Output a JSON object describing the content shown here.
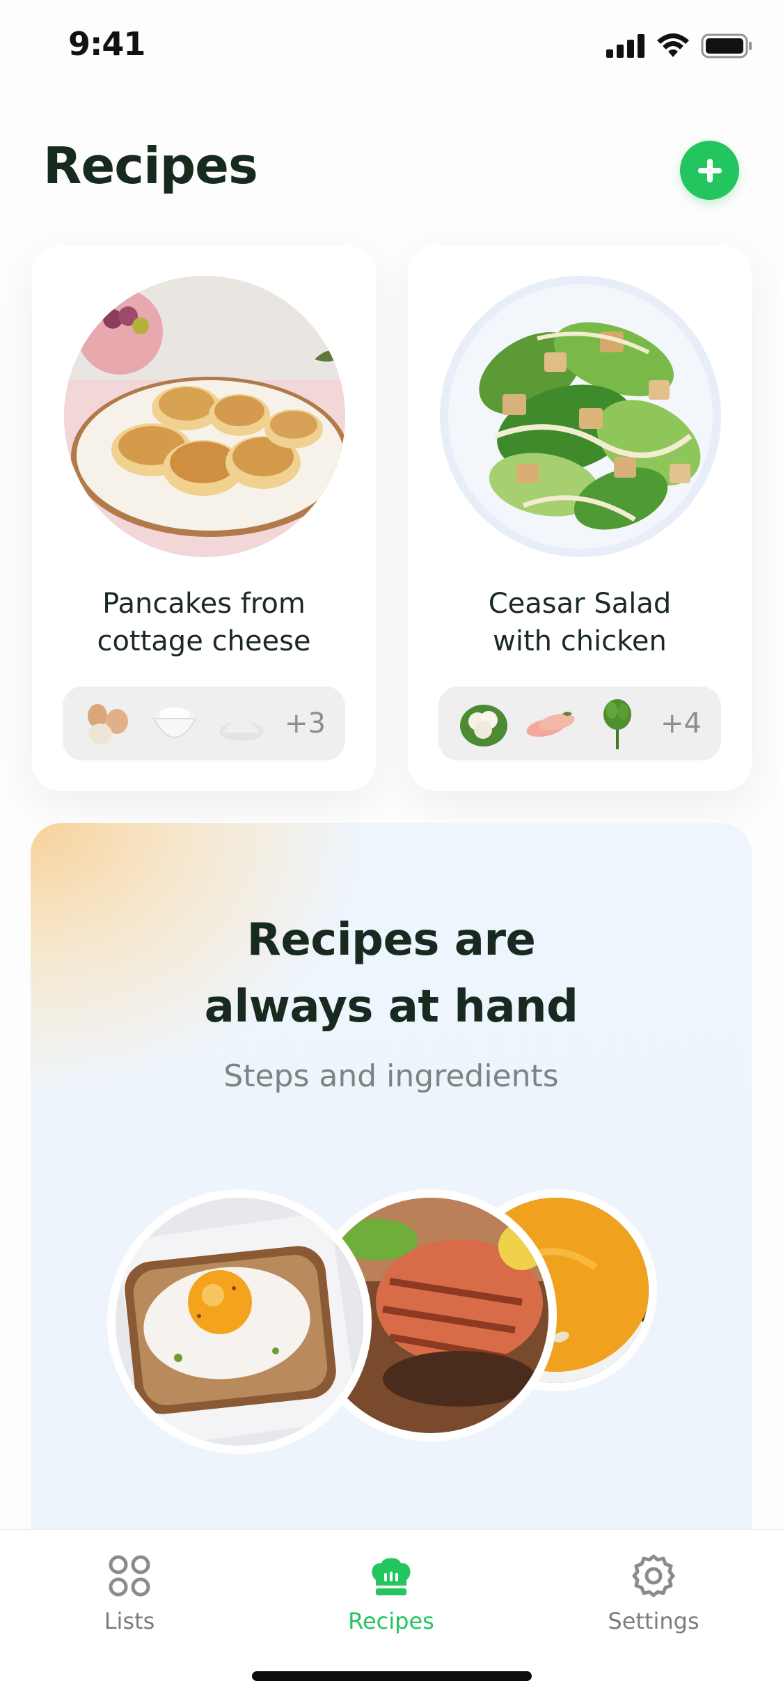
{
  "status_bar": {
    "time": "9:41",
    "icons": [
      "signal-icon",
      "wifi-icon",
      "battery-icon"
    ]
  },
  "header": {
    "title": "Recipes",
    "add_icon": "plus-icon"
  },
  "recipes": [
    {
      "name": "Pancakes from cottage cheese",
      "name_line1": "Pancakes from",
      "name_line2": "cottage cheese",
      "ingredients": [
        "eggs-icon",
        "flour-bowl-icon",
        "sugar-pile-icon"
      ],
      "more": "+3"
    },
    {
      "name": "Ceasar Salad with chicken",
      "name_line1": "Ceasar Salad",
      "name_line2": "with chicken",
      "ingredients": [
        "cauliflower-icon",
        "chicken-breast-icon",
        "dill-icon"
      ],
      "more": "+4"
    }
  ],
  "promo": {
    "title_line1": "Recipes are",
    "title_line2": "always at hand",
    "subtitle": "Steps and ingredients",
    "dishes": [
      "egg-toast",
      "grilled-salmon",
      "pumpkin-soup"
    ]
  },
  "tab_bar": {
    "tabs": [
      {
        "label": "Lists",
        "icon": "grid-circles-icon",
        "active": false
      },
      {
        "label": "Recipes",
        "icon": "chef-hat-icon",
        "active": true
      },
      {
        "label": "Settings",
        "icon": "gear-icon",
        "active": false
      }
    ]
  },
  "colors": {
    "accent": "#22c55e",
    "text_dark": "#162a1e",
    "muted": "#7d8381"
  }
}
